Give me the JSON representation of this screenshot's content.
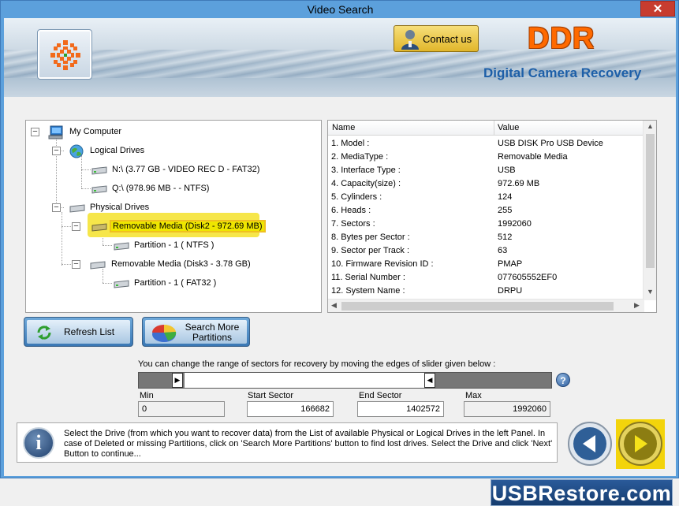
{
  "window": {
    "title": "Video Search",
    "close_glyph": "✕"
  },
  "banner": {
    "contact_label": "Contact us",
    "brand_logo": "DDR",
    "product_name": "Digital Camera Recovery"
  },
  "tree": {
    "items": [
      {
        "label": "My Computer",
        "icon": "computer-icon"
      },
      {
        "label": "Logical Drives",
        "icon": "globe-icon"
      },
      {
        "label": "N:\\ (3.77 GB - VIDEO REC D - FAT32)",
        "icon": "drive-icon"
      },
      {
        "label": "Q:\\ (978.96 MB -  - NTFS)",
        "icon": "drive-icon"
      },
      {
        "label": "Physical Drives",
        "icon": "drive-icon"
      },
      {
        "label": "Removable Media (Disk2 - 972.69 MB)",
        "icon": "drive-icon",
        "selected": true
      },
      {
        "label": "Partition - 1 ( NTFS )",
        "icon": "drive-icon"
      },
      {
        "label": "Removable Media (Disk3 - 3.78 GB)",
        "icon": "drive-icon"
      },
      {
        "label": "Partition - 1 ( FAT32 )",
        "icon": "drive-icon"
      }
    ]
  },
  "properties": {
    "headers": {
      "name": "Name",
      "value": "Value"
    },
    "rows": [
      {
        "name": "1. Model :",
        "value": "USB DISK Pro USB Device"
      },
      {
        "name": "2. MediaType :",
        "value": "Removable Media"
      },
      {
        "name": "3. Interface Type :",
        "value": "USB"
      },
      {
        "name": "4. Capacity(size) :",
        "value": "972.69 MB"
      },
      {
        "name": "5. Cylinders :",
        "value": "124"
      },
      {
        "name": "6. Heads :",
        "value": "255"
      },
      {
        "name": "7. Sectors :",
        "value": "1992060"
      },
      {
        "name": "8. Bytes per Sector :",
        "value": "512"
      },
      {
        "name": "9. Sector per Track :",
        "value": "63"
      },
      {
        "name": "10. Firmware Revision ID :",
        "value": "PMAP"
      },
      {
        "name": "11. Serial Number :",
        "value": "077605552EF0"
      },
      {
        "name": "12. System Name :",
        "value": "DRPU"
      }
    ]
  },
  "buttons": {
    "refresh": "Refresh List",
    "search_more_line1": "Search More",
    "search_more_line2": "Partitions"
  },
  "slider": {
    "hint": "You can change the range of sectors for recovery by moving the edges of slider given below :",
    "help_glyph": "?",
    "min_label": "Min",
    "min_value": "0",
    "start_label": "Start Sector",
    "start_value": "166682",
    "end_label": "End Sector",
    "end_value": "1402572",
    "max_label": "Max",
    "max_value": "1992060"
  },
  "info": {
    "icon_glyph": "i",
    "text": "Select the Drive (from which you want to recover data) from the List of available Physical or Logical Drives in the left Panel. In case of Deleted or missing Partitions, click on 'Search More Partitions' button to find lost drives. Select the Drive and click 'Next' Button to continue..."
  },
  "footer": {
    "brand": "USBRestore.com"
  },
  "colors": {
    "accent": "#5ca0dc",
    "selection": "#eee600",
    "brand_orange": "#ff6a00"
  }
}
